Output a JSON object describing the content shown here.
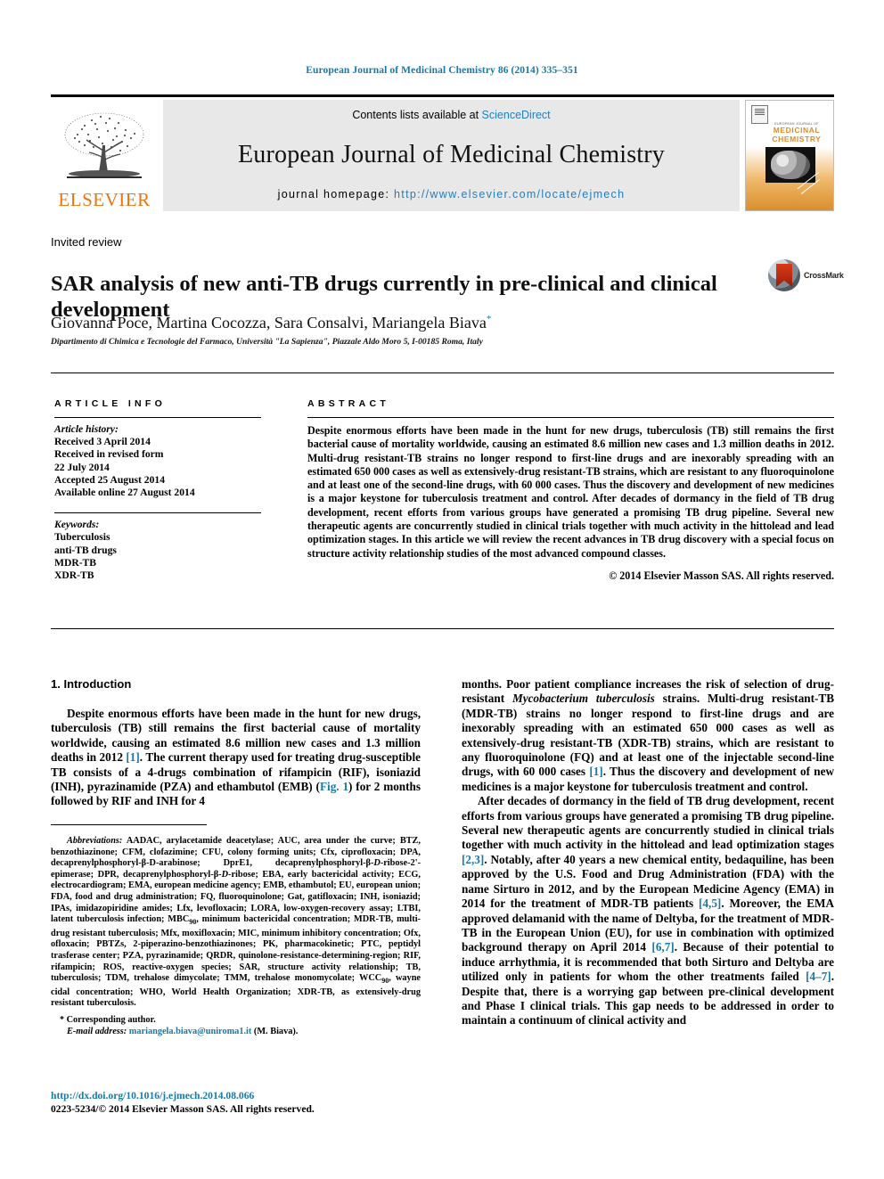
{
  "running_head": "European Journal of Medicinal Chemistry 86 (2014) 335–351",
  "masthead": {
    "contents_prefix": "Contents lists available at ",
    "sciencedirect": "ScienceDirect",
    "journal_title": "European Journal of Medicinal Chemistry",
    "homepage_label": "journal homepage: ",
    "homepage_url": "http://www.elsevier.com/locate/ejmech",
    "publisher_logo_text": "ELSEVIER",
    "cover": {
      "kicker": "EUROPEAN JOURNAL OF",
      "title_line1": "MEDICINAL",
      "title_line2": "CHEMISTRY"
    },
    "link_color": "#1f7fc0",
    "panel_bg": "#e8e8e8"
  },
  "article": {
    "type": "Invited review",
    "title": "SAR analysis of new anti-TB drugs currently in pre-clinical and clinical development",
    "authors": "Giovanna Poce, Martina Cocozza, Sara Consalvi, Mariangela Biava",
    "corresponding_marker": "*",
    "affiliation": "Dipartimento di Chimica e Tecnologie del Farmaco, Università \"La Sapienza\", Piazzale Aldo Moro 5, I-00185 Roma, Italy",
    "crossmark_label": "CrossMark"
  },
  "info": {
    "heading": "ARTICLE INFO",
    "history_label": "Article history:",
    "history": [
      "Received 3 April 2014",
      "Received in revised form",
      "22 July 2014",
      "Accepted 25 August 2014",
      "Available online 27 August 2014"
    ],
    "keywords_label": "Keywords:",
    "keywords": [
      "Tuberculosis",
      "anti-TB drugs",
      "MDR-TB",
      "XDR-TB"
    ]
  },
  "abstract": {
    "heading": "ABSTRACT",
    "text": "Despite enormous efforts have been made in the hunt for new drugs, tuberculosis (TB) still remains the first bacterial cause of mortality worldwide, causing an estimated 8.6 million new cases and 1.3 million deaths in 2012. Multi-drug resistant-TB strains no longer respond to first-line drugs and are inexorably spreading with an estimated 650 000 cases as well as extensively-drug resistant-TB strains, which are resistant to any fluoroquinolone and at least one of the second-line drugs, with 60 000 cases. Thus the discovery and development of new medicines is a major keystone for tuberculosis treatment and control. After decades of dormancy in the field of TB drug development, recent efforts from various groups have generated a promising TB drug pipeline. Several new therapeutic agents are concurrently studied in clinical trials together with much activity in the hittolead and lead optimization stages. In this article we will review the recent advances in TB drug discovery with a special focus on structure activity relationship studies of the most advanced compound classes.",
    "copyright": "© 2014 Elsevier Masson SAS. All rights reserved."
  },
  "body": {
    "section_number_title": "1. Introduction",
    "left_p1_a": "Despite enormous efforts have been made in the hunt for new drugs, tuberculosis (TB) still remains the first bacterial cause of mortality worldwide, causing an estimated 8.6 million new cases and 1.3 million deaths in 2012 ",
    "left_p1_ref1": "[1]",
    "left_p1_b": ". The current therapy used for treating drug-susceptible TB consists of a 4-drugs combination of rifampicin (RIF), isoniazid (INH), pyrazinamide (PZA) and ethambutol (EMB) (",
    "left_p1_figref": "Fig. 1",
    "left_p1_c": ") for 2 months followed by RIF and INH for 4",
    "right_p1_a": "months. Poor patient compliance increases the risk of selection of drug-resistant ",
    "right_p1_italic": "Mycobacterium tuberculosis",
    "right_p1_b": " strains. Multi-drug resistant-TB (MDR-TB) strains no longer respond to first-line drugs and are inexorably spreading with an estimated 650 000 cases as well as extensively-drug resistant-TB (XDR-TB) strains, which are resistant to any fluoroquinolone (FQ) and at least one of the injectable second-line drugs, with 60 000 cases ",
    "right_p1_ref": "[1]",
    "right_p1_c": ". Thus the discovery and development of new medicines is a major keystone for tuberculosis treatment and control.",
    "right_p2_a": "After decades of dormancy in the field of TB drug development, recent efforts from various groups have generated a promising TB drug pipeline. Several new therapeutic agents are concurrently studied in clinical trials together with much activity in the hittolead and lead optimization stages ",
    "right_p2_ref1": "[2,3]",
    "right_p2_b": ". Notably, after 40 years a new chemical entity, bedaquiline, has been approved by the U.S. Food and Drug Administration (FDA) with the name Sirturo in 2012, and by the European Medicine Agency (EMA) in 2014 for the treatment of MDR-TB patients ",
    "right_p2_ref2": "[4,5]",
    "right_p2_c": ". Moreover, the EMA approved delamanid with the name of Deltyba, for the treatment of MDR-TB in the European Union (EU), for use in combination with optimized background therapy on April 2014 ",
    "right_p2_ref3": "[6,7]",
    "right_p2_d": ". Because of their potential to induce arrhythmia, it is recommended that both Sirturo and Deltyba are utilized only in patients for whom the other treatments failed ",
    "right_p2_ref4": "[4–7]",
    "right_p2_e": ". Despite that, there is a worrying gap between pre-clinical development and Phase I clinical trials. This gap needs to be addressed in order to maintain a continuum of clinical activity and"
  },
  "footnotes": {
    "abbrev_label": "Abbreviations:",
    "abbrev_text_1": " AADAC, arylacetamide deacetylase; AUC, area under the curve; BTZ, benzothiazinone; CFM, clofazimine; CFU, colony forming units; Cfx, ciprofloxacin; DPA, decaprenylphosphoryl-β-D-arabinose; DprE1, decaprenylphosphoryl-β-",
    "abbrev_text_2": "-ribose-2'-epimerase; DPR, decaprenylphosphoryl-β-",
    "abbrev_text_3": "-ribose; EBA, early bactericidal activity; ECG, electrocardiogram; EMA, european medicine agency; EMB, ethambutol; EU, european union; FDA, food and drug administration; FQ, fluoroquinolone; Gat, gatifloxacin; INH, isoniazid; IPAs, imidazopiridine amides; Lfx, levofloxacin; LORA, low-oxygen-recovery assay; LTBI, latent tuberculosis infection; MBC",
    "abbrev_sub_90_a": "90",
    "abbrev_text_4": ", minimum bactericidal concentration; MDR-TB, multi-drug resistant tuberculosis; Mfx, moxifloxacin; MIC, minimum inhibitory concentration; Ofx, ofloxacin; PBTZs, 2-piperazino-benzothiazinones; PK, pharmacokinetic; PTC, peptidyl trasferase center; PZA, pyrazinamide; QRDR, quinolone-resistance-determining-region; RIF, rifampicin; ROS, reactive-oxygen species; SAR, structure activity relationship; TB, tuberculosis; TDM, trehalose dimycolate; TMM, trehalose monomycolate; WCC",
    "abbrev_sub_90_b": "90",
    "abbrev_text_5": ", wayne cidal concentration; WHO, World Health Organization; XDR-TB, as extensively-drug resistant tuberculosis.",
    "corresponding": "Corresponding author.",
    "email_label": "E-mail address:",
    "email": "mariangela.biava@uniroma1.it",
    "email_suffix": " (M. Biava)."
  },
  "doi_block": {
    "doi_url": "http://dx.doi.org/10.1016/j.ejmech.2014.08.066",
    "issn_line": "0223-5234/© 2014 Elsevier Masson SAS. All rights reserved."
  }
}
